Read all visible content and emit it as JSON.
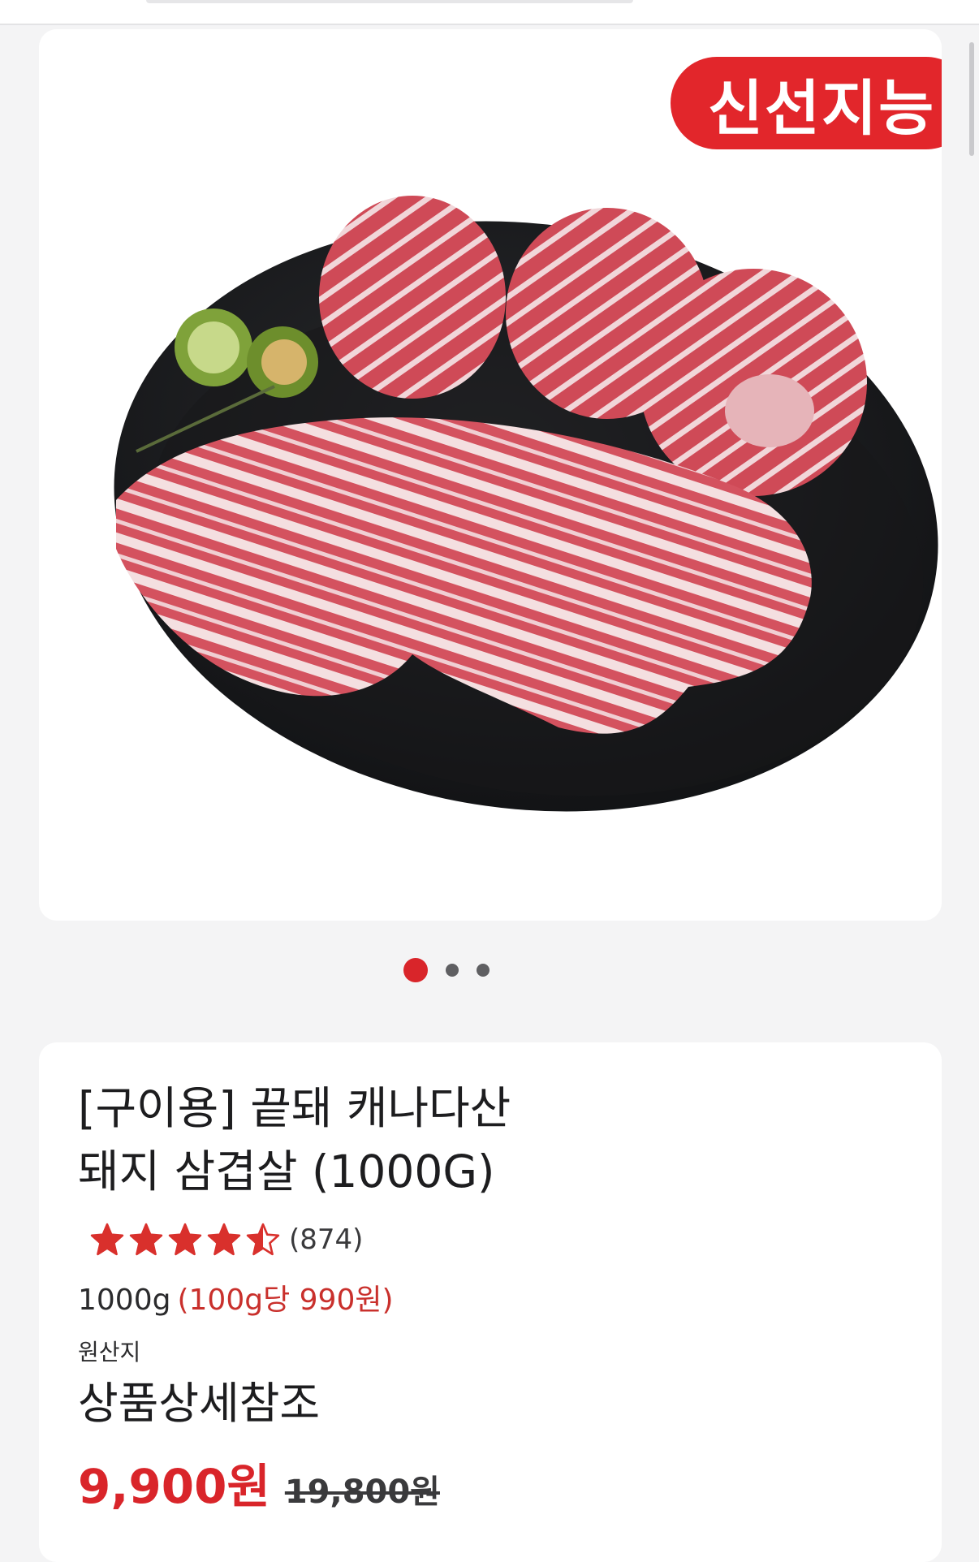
{
  "badge": {
    "text": "신선지능"
  },
  "carousel": {
    "total": 3,
    "active_index": 0
  },
  "product": {
    "title_line1": "[구이용] 끝돼 캐나다산",
    "title_line2": "돼지 삼겹살 (1000G)",
    "rating": 4.5,
    "review_count": "(874)",
    "weight": "1000g",
    "unit_price": "(100g당 990원)",
    "origin_label": "원산지",
    "origin_value": "상품상세참조",
    "sale_price": "9,900원",
    "original_price": "19,800원"
  },
  "colors": {
    "accent": "#d9252a",
    "star": "#d9302c",
    "background": "#f4f4f5"
  },
  "icons": {
    "star": "star-icon",
    "half_star": "half-star-icon"
  }
}
